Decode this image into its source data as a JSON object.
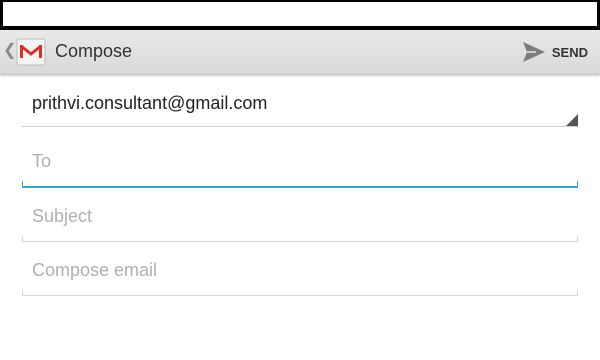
{
  "action_bar": {
    "title": "Compose",
    "send_label": "SEND",
    "app_icon": "gmail-icon",
    "send_icon": "send-icon",
    "up_icon": "back-caret-icon"
  },
  "form": {
    "from_account": "prithvi.consultant@gmail.com",
    "to_placeholder": "To",
    "subject_placeholder": "Subject",
    "body_placeholder": "Compose email"
  },
  "colors": {
    "focus_accent": "#33a6c7",
    "gmail_red": "#d93025",
    "action_bar": "#e0e0e0"
  }
}
